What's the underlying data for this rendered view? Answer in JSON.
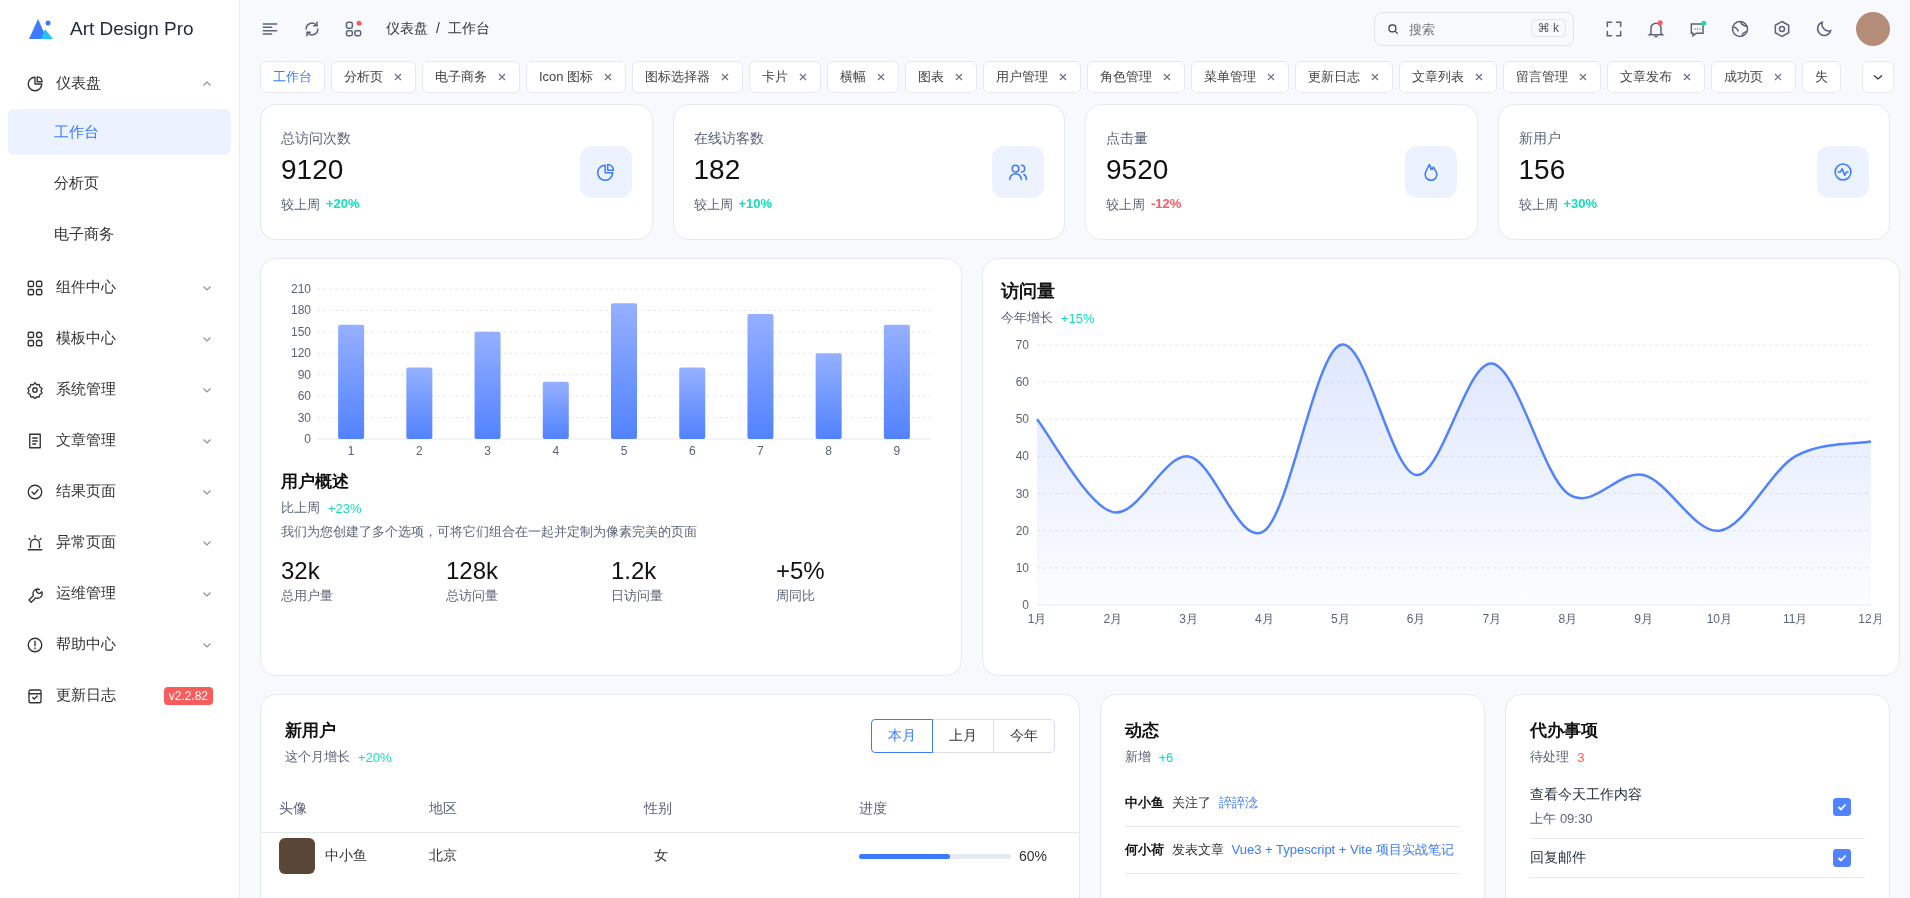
{
  "brand": {
    "name": "Art Design Pro"
  },
  "sidebar": {
    "items": [
      {
        "label": "仪表盘",
        "kind": "group",
        "expanded": true,
        "children": [
          {
            "label": "工作台",
            "selected": true
          },
          {
            "label": "分析页",
            "selected": false
          },
          {
            "label": "电子商务",
            "selected": false
          }
        ]
      },
      {
        "label": "组件中心",
        "kind": "group",
        "expanded": false
      },
      {
        "label": "模板中心",
        "kind": "group",
        "expanded": false
      },
      {
        "label": "系统管理",
        "kind": "group",
        "expanded": false
      },
      {
        "label": "文章管理",
        "kind": "group",
        "expanded": false
      },
      {
        "label": "结果页面",
        "kind": "group",
        "expanded": false
      },
      {
        "label": "异常页面",
        "kind": "group",
        "expanded": false
      },
      {
        "label": "运维管理",
        "kind": "group",
        "expanded": false
      },
      {
        "label": "帮助中心",
        "kind": "group",
        "expanded": false
      },
      {
        "label": "更新日志",
        "kind": "link",
        "badge": "v2.2.82"
      }
    ]
  },
  "header": {
    "breadcrumb": [
      "仪表盘",
      "工作台"
    ],
    "separator": "/",
    "search": {
      "placeholder": "搜索",
      "shortcut": "⌘ k"
    }
  },
  "tabs": [
    {
      "label": "工作台",
      "selected": true,
      "closable": false
    },
    {
      "label": "分析页",
      "selected": false,
      "closable": true
    },
    {
      "label": "电子商务",
      "selected": false,
      "closable": true
    },
    {
      "label": "Icon 图标",
      "selected": false,
      "closable": true
    },
    {
      "label": "图标选择器",
      "selected": false,
      "closable": true
    },
    {
      "label": "卡片",
      "selected": false,
      "closable": true
    },
    {
      "label": "横幅",
      "selected": false,
      "closable": true
    },
    {
      "label": "图表",
      "selected": false,
      "closable": true
    },
    {
      "label": "用户管理",
      "selected": false,
      "closable": true
    },
    {
      "label": "角色管理",
      "selected": false,
      "closable": true
    },
    {
      "label": "菜单管理",
      "selected": false,
      "closable": true
    },
    {
      "label": "更新日志",
      "selected": false,
      "closable": true
    },
    {
      "label": "文章列表",
      "selected": false,
      "closable": true
    },
    {
      "label": "留言管理",
      "selected": false,
      "closable": true
    },
    {
      "label": "文章发布",
      "selected": false,
      "closable": true
    },
    {
      "label": "成功页",
      "selected": false,
      "closable": true
    },
    {
      "label": "失",
      "selected": false,
      "closable": false
    }
  ],
  "stats": [
    {
      "title": "总访问次数",
      "value": "9120",
      "compare_label": "较上周",
      "change": "+20%",
      "color": "#13deb9"
    },
    {
      "title": "在线访客数",
      "value": "182",
      "compare_label": "较上周",
      "change": "+10%",
      "color": "#13deb9"
    },
    {
      "title": "点击量",
      "value": "9520",
      "compare_label": "较上周",
      "change": "-12%",
      "color": "#fa5c5c"
    },
    {
      "title": "新用户",
      "value": "156",
      "compare_label": "较上周",
      "change": "+30%",
      "color": "#13deb9"
    }
  ],
  "overview": {
    "chart_data": {
      "type": "bar",
      "categories": [
        "1",
        "2",
        "3",
        "4",
        "5",
        "6",
        "7",
        "8",
        "9"
      ],
      "values": [
        160,
        100,
        150,
        80,
        190,
        100,
        175,
        120,
        160
      ],
      "ylim": [
        0,
        210
      ],
      "yticks": [
        0,
        30,
        60,
        90,
        120,
        150,
        180,
        210
      ],
      "grid": true
    },
    "title": "用户概述",
    "compare_label": "比上周",
    "change": "+23%",
    "description": "我们为您创建了多个选项，可将它们组合在一起并定制为像素完美的页面",
    "metrics": [
      {
        "value": "32k",
        "label": "总用户量"
      },
      {
        "value": "128k",
        "label": "总访问量"
      },
      {
        "value": "1.2k",
        "label": "日访问量"
      },
      {
        "value": "+5%",
        "label": "周同比"
      }
    ]
  },
  "visits": {
    "title": "访问量",
    "subtitle": "今年增长",
    "change": "+15%",
    "chart_data": {
      "type": "area",
      "categories": [
        "1月",
        "2月",
        "3月",
        "4月",
        "5月",
        "6月",
        "7月",
        "8月",
        "9月",
        "10月",
        "11月",
        "12月"
      ],
      "values": [
        50,
        25,
        40,
        20,
        70,
        35,
        65,
        30,
        35,
        20,
        40,
        44
      ],
      "ylim": [
        0,
        70
      ],
      "yticks": [
        0,
        10,
        20,
        30,
        40,
        50,
        60,
        70
      ],
      "grid": true
    }
  },
  "new_users": {
    "title": "新用户",
    "subtitle": "这个月增长",
    "change": "+20%",
    "periods": [
      {
        "label": "本月",
        "selected": true
      },
      {
        "label": "上月",
        "selected": false
      },
      {
        "label": "今年",
        "selected": false
      }
    ],
    "columns": [
      "头像",
      "地区",
      "性别",
      "进度"
    ],
    "rows": [
      {
        "name": "中小鱼",
        "region": "北京",
        "gender": "女",
        "level": 0.6,
        "progress": "60%"
      }
    ]
  },
  "activity": {
    "title": "动态",
    "subtitle": "新增",
    "change": "+6",
    "items": [
      {
        "user": "中小鱼",
        "action": "关注了",
        "target": "誶誶淰"
      },
      {
        "user": "何小荷",
        "action": "发表文章",
        "target": "Vue3 + Typescript + Vite 项目实战笔记"
      }
    ]
  },
  "todos": {
    "title": "代办事项",
    "subtitle": "待处理",
    "count": "3",
    "items": [
      {
        "text": "查看今天工作内容",
        "time": "上午 09:30",
        "checked": true
      },
      {
        "text": "回复邮件",
        "checked": true
      }
    ]
  }
}
